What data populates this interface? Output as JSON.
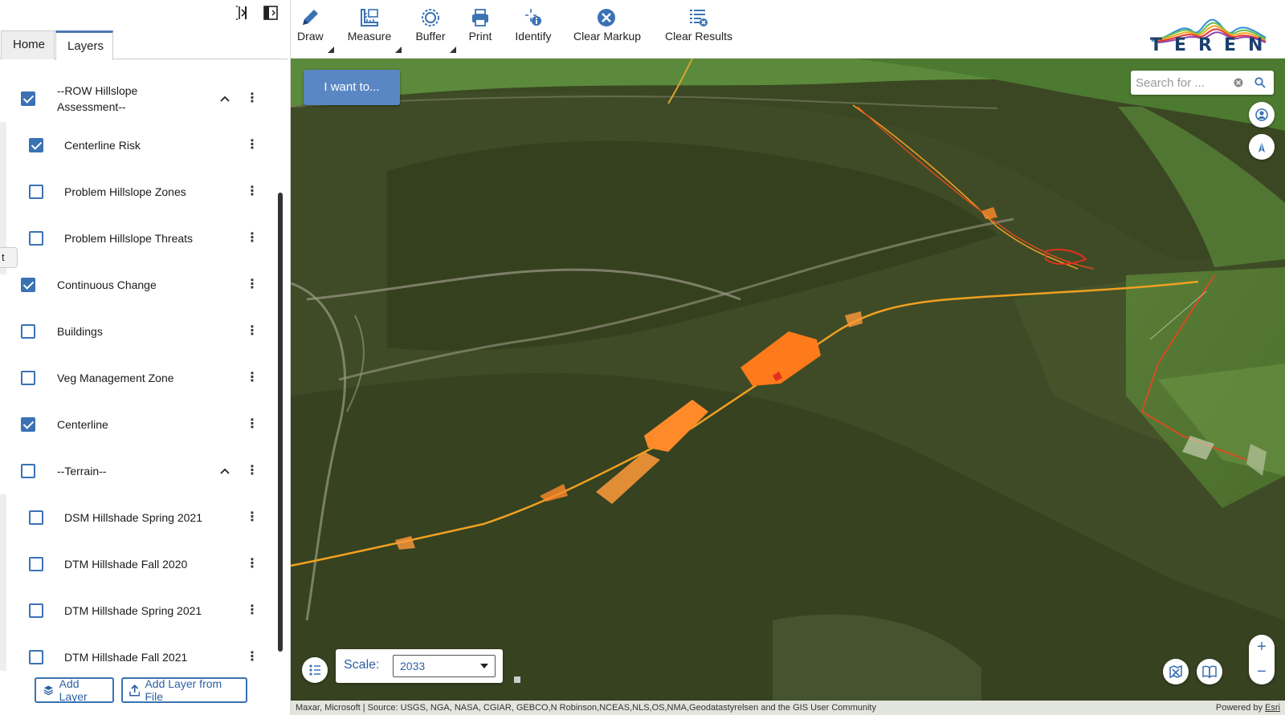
{
  "tabs": {
    "home": "Home",
    "layers": "Layers"
  },
  "layers": [
    {
      "label": "--ROW Hillslope Assessment--",
      "checked": true,
      "group": true,
      "expanded": true
    },
    {
      "label": "Centerline Risk",
      "checked": true,
      "indent": true
    },
    {
      "label": "Problem Hillslope Zones",
      "checked": false,
      "indent": true
    },
    {
      "label": "Problem Hillslope Threats",
      "checked": false,
      "indent": true
    },
    {
      "label": "Continuous Change",
      "checked": true
    },
    {
      "label": "Buildings",
      "checked": false
    },
    {
      "label": "Veg Management Zone",
      "checked": false
    },
    {
      "label": "Centerline",
      "checked": true
    },
    {
      "label": "--Terrain--",
      "checked": false,
      "group": true,
      "expanded": true
    },
    {
      "label": "DSM Hillshade Spring 2021",
      "checked": false,
      "indent": true
    },
    {
      "label": "DTM Hillshade Fall 2020",
      "checked": false,
      "indent": true
    },
    {
      "label": "DTM Hillshade Spring 2021",
      "checked": false,
      "indent": true
    },
    {
      "label": "DTM Hillshade Fall 2021",
      "checked": false,
      "indent": true
    }
  ],
  "layer_labels": {
    "l0": "--ROW Hillslope Assessment--",
    "l1": "Centerline Risk",
    "l2": "Problem Hillslope Zones",
    "l3": "Problem Hillslope Threats",
    "l4": "Continuous Change",
    "l5": "Buildings",
    "l6": "Veg Management Zone",
    "l7": "Centerline",
    "l8": "--Terrain--",
    "l9": "DSM Hillshade Spring 2021",
    "l10": "DTM Hillshade Fall 2020",
    "l11": "DTM Hillshade Spring 2021",
    "l12": "DTM Hillshade Fall 2021"
  },
  "kebab_glyph": "⋮",
  "side_flyout": "t",
  "panel_buttons": {
    "add_layer": "Add Layer",
    "add_from_file": "Add Layer from File"
  },
  "toolbar": {
    "draw": "Draw",
    "measure": "Measure",
    "buffer": "Buffer",
    "print": "Print",
    "identify": "Identify",
    "clear_markup": "Clear Markup",
    "clear_results": "Clear Results"
  },
  "logo": {
    "text": "TEREN"
  },
  "map": {
    "i_want_to": "I want to...",
    "search_placeholder": "Search for ...",
    "zoom_in": "+",
    "zoom_out": "−",
    "scale_label": "Scale:",
    "scale_value": "2033",
    "attribution": "Maxar, Microsoft | Source: USGS, NGA, NASA, CGIAR, GEBCO,N Robinson,NCEAS,NLS,OS,NMA,Geodatastyrelsen and the GIS User Community",
    "powered_by": "Powered by ",
    "powered_by_link": "Esri"
  },
  "colors": {
    "accent": "#3a72b4",
    "button_blue": "#5a87c4",
    "centerline": "#f0a020",
    "risk_orange": "#ff7a1a",
    "risk_red": "#e0301e"
  },
  "icons": [
    "panel-collapse-icon",
    "panel-dock-icon",
    "chevron-up-icon",
    "kebab-menu-icon",
    "pencil-icon",
    "ruler-icon",
    "buffer-icon",
    "printer-icon",
    "identify-icon",
    "clear-x-icon",
    "clear-list-icon",
    "search-icon",
    "clear-search-icon",
    "locate-icon",
    "compass-icon",
    "legend-icon",
    "basemap-icon",
    "bookmark-icon"
  ]
}
